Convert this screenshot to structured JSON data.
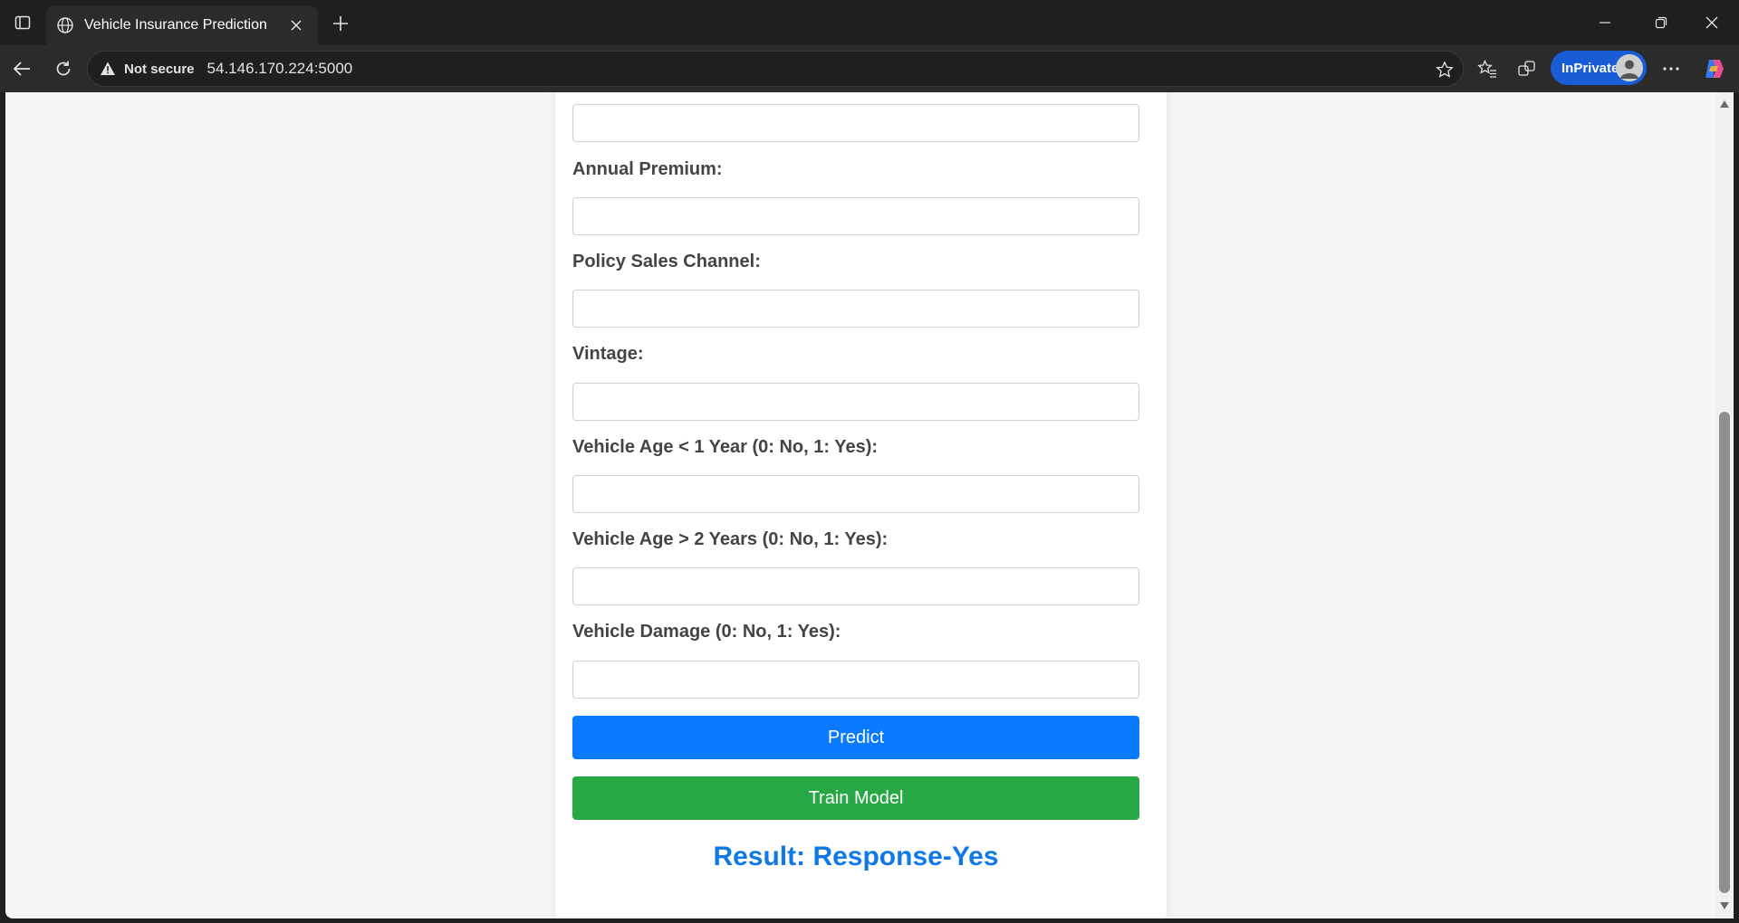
{
  "browser": {
    "tab_title": "Vehicle Insurance Prediction",
    "security_label": "Not secure",
    "url": "54.146.170.224:5000",
    "inprivate_label": "InPrivate",
    "icons": {
      "tab_actions": "tab-actions-icon",
      "tab_favicon": "globe-icon",
      "tab_close": "close-icon",
      "new_tab": "plus-icon",
      "minimize": "minimize-icon",
      "restore": "restore-icon",
      "window_close": "close-icon",
      "back": "back-arrow-icon",
      "refresh": "refresh-icon",
      "warning": "warning-icon",
      "favorite": "star-icon",
      "favorites": "favorites-icon",
      "collections": "collections-icon",
      "more": "more-icon",
      "copilot": "copilot-icon"
    }
  },
  "form": {
    "fields": [
      {
        "label": "",
        "value": ""
      },
      {
        "label": "Annual Premium:",
        "value": ""
      },
      {
        "label": "Policy Sales Channel:",
        "value": ""
      },
      {
        "label": "Vintage:",
        "value": ""
      },
      {
        "label": "Vehicle Age < 1 Year (0: No, 1: Yes):",
        "value": ""
      },
      {
        "label": "Vehicle Age > 2 Years (0: No, 1: Yes):",
        "value": ""
      },
      {
        "label": "Vehicle Damage (0: No, 1: Yes):",
        "value": ""
      }
    ],
    "predict_label": "Predict",
    "train_label": "Train Model",
    "result_text": "Result: Response-Yes"
  },
  "colors": {
    "predict_button": "#0a7bff",
    "train_button": "#28a745",
    "result_text": "#1079e8",
    "inprivate_badge": "#1a5bd6"
  }
}
